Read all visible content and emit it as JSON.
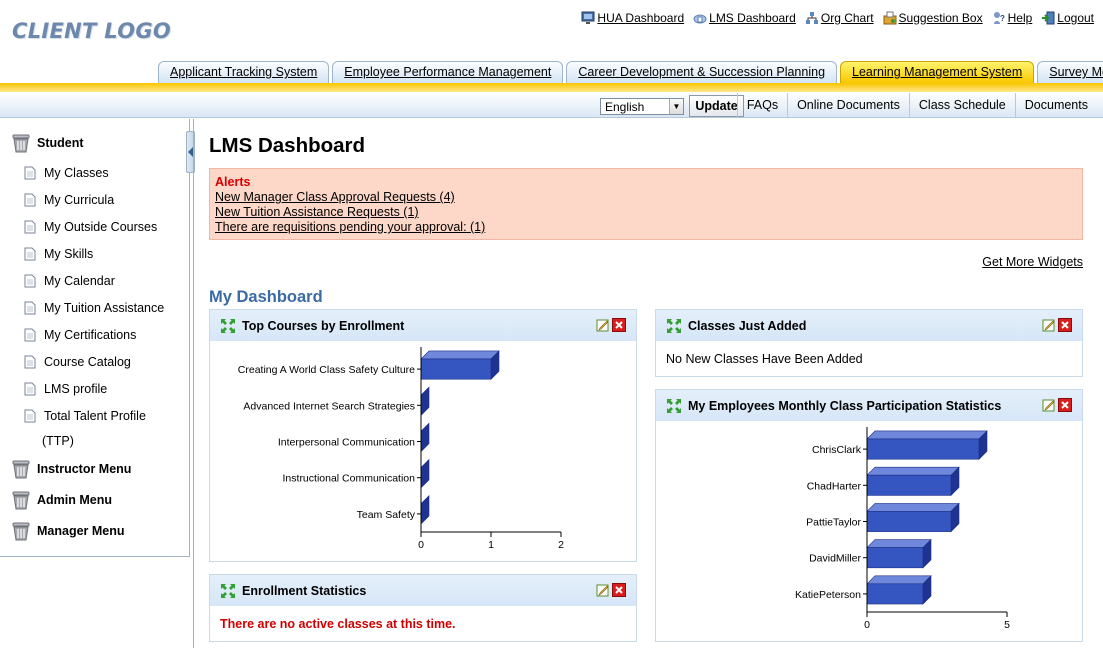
{
  "header": {
    "logo_text": "CLIENT LOGO",
    "links": [
      {
        "label": "HUA Dashboard",
        "icon": "monitor-icon"
      },
      {
        "label": "LMS Dashboard",
        "icon": "cloud-home-icon"
      },
      {
        "label": "Org Chart",
        "icon": "org-chart-icon"
      },
      {
        "label": "Suggestion Box",
        "icon": "suggestion-box-icon"
      },
      {
        "label": "Help",
        "icon": "help-icon"
      },
      {
        "label": "Logout",
        "icon": "logout-icon"
      }
    ]
  },
  "tabs": [
    {
      "label": "Applicant Tracking System",
      "active": false
    },
    {
      "label": "Employee Performance Management",
      "active": false
    },
    {
      "label": "Career Development & Succession Planning",
      "active": false
    },
    {
      "label": "Learning Management System",
      "active": true
    },
    {
      "label": "Survey Module",
      "active": false
    }
  ],
  "subbar": {
    "language_value": "English",
    "update_label": "Update",
    "links": [
      "FAQs",
      "Online Documents",
      "Class Schedule",
      "Documents"
    ]
  },
  "sidebar": {
    "student_label": "Student",
    "student_items": [
      "My Classes",
      "My Curricula",
      "My Outside Courses",
      "My Skills",
      "My Calendar",
      "My Tuition Assistance",
      "My Certifications",
      "Course Catalog",
      "LMS profile",
      "Total Talent Profile"
    ],
    "ttp_suffix": "(TTP)",
    "instructor_label": "Instructor Menu",
    "admin_label": "Admin Menu",
    "manager_label": "Manager Menu"
  },
  "main": {
    "title": "LMS Dashboard",
    "alerts_title": "Alerts",
    "alerts": [
      "New Manager Class Approval Requests (4)",
      "New Tuition Assistance Requests (1)",
      "There are requisitions pending your approval:  (1)"
    ],
    "more_widgets": "Get More Widgets",
    "dashboard_title": "My Dashboard"
  },
  "widgets": {
    "top_courses": {
      "title": "Top Courses by Enrollment"
    },
    "enrollment_stats": {
      "title": "Enrollment Statistics",
      "message": "There are no active classes at this time."
    },
    "classes_added": {
      "title": "Classes Just Added",
      "message": "No New Classes Have Been Added"
    },
    "employee_stats": {
      "title": "My Employees Monthly Class Participation Statistics"
    }
  },
  "colors": {
    "accent_tab": "#f9c800",
    "bar": "#3353b8",
    "alert_bg": "#fdd7c8",
    "alert_text": "#d80000"
  },
  "chart_data": [
    {
      "type": "bar",
      "orientation": "horizontal",
      "categories": [
        "Creating A World Class Safety Culture",
        "Advanced Internet Search Strategies",
        "Interpersonal Communication",
        "Instructional Communication",
        "Team Safety"
      ],
      "values": [
        1,
        0,
        0,
        0,
        0
      ],
      "xlim": [
        0,
        2
      ],
      "xticks": [
        0,
        1,
        2
      ],
      "title": "Top Courses by Enrollment"
    },
    {
      "type": "bar",
      "orientation": "horizontal",
      "categories": [
        "ChrisClark",
        "ChadHarter",
        "PattieTaylor",
        "DavidMiller",
        "KatiePeterson"
      ],
      "values": [
        4,
        3,
        3,
        2,
        2
      ],
      "xlim": [
        0,
        5
      ],
      "xticks": [
        0,
        5
      ],
      "title": "My Employees Monthly Class Participation Statistics"
    }
  ]
}
